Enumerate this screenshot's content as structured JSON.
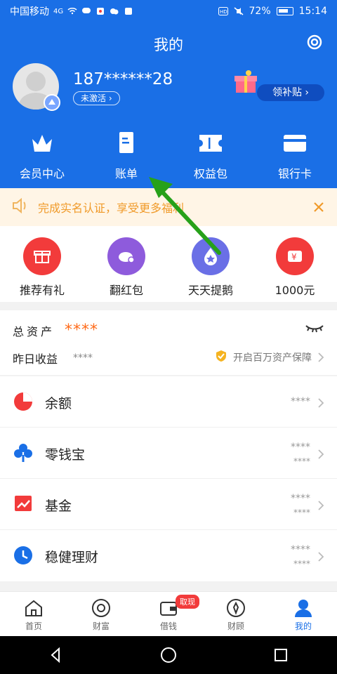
{
  "status": {
    "carrier": "中国移动",
    "network": "4G",
    "battery": "72%",
    "time": "15:14"
  },
  "header": {
    "title": "我的",
    "phone": "187******28",
    "activate_label": "未激活",
    "subsidy_label": "领补贴"
  },
  "quick_actions": [
    {
      "label": "会员中心",
      "icon": "crown-icon"
    },
    {
      "label": "账单",
      "icon": "bill-icon"
    },
    {
      "label": "权益包",
      "icon": "ticket-icon"
    },
    {
      "label": "银行卡",
      "icon": "card-icon"
    }
  ],
  "notice": {
    "text": "完成实名认证，享受更多福利"
  },
  "features": [
    {
      "label": "推荐有礼",
      "color": "#f23b3b",
      "icon": "gift-icon"
    },
    {
      "label": "翻红包",
      "color": "#8e5bdc",
      "icon": "piggy-icon"
    },
    {
      "label": "天天提鹅",
      "color": "#6a6fe6",
      "icon": "drop-star-icon"
    },
    {
      "label": "1000元",
      "color": "#f23b3b",
      "icon": "yen-ticket-icon"
    }
  ],
  "assets": {
    "title": "总资产",
    "amount_mask": "****",
    "yesterday_label": "昨日收益",
    "yesterday_mask": "****",
    "protect_text": "开启百万资产保障"
  },
  "list": [
    {
      "label": "余额",
      "top": "****",
      "sub": "",
      "icon": "pie-icon",
      "color": "#f23b3b"
    },
    {
      "label": "零钱宝",
      "top": "****",
      "sub": "****",
      "icon": "clover-icon",
      "color": "#1a6fe6"
    },
    {
      "label": "基金",
      "top": "****",
      "sub": "****",
      "icon": "chart-icon",
      "color": "#f23b3b"
    },
    {
      "label": "稳健理财",
      "top": "****",
      "sub": "****",
      "icon": "clock-icon",
      "color": "#1a6fe6"
    }
  ],
  "bottom_nav": [
    {
      "label": "首页",
      "icon": "home-icon"
    },
    {
      "label": "财富",
      "icon": "coin-icon"
    },
    {
      "label": "借钱",
      "icon": "wallet-icon",
      "badge": "取现"
    },
    {
      "label": "财顾",
      "icon": "advisor-icon"
    },
    {
      "label": "我的",
      "icon": "user-icon",
      "active": true
    }
  ]
}
